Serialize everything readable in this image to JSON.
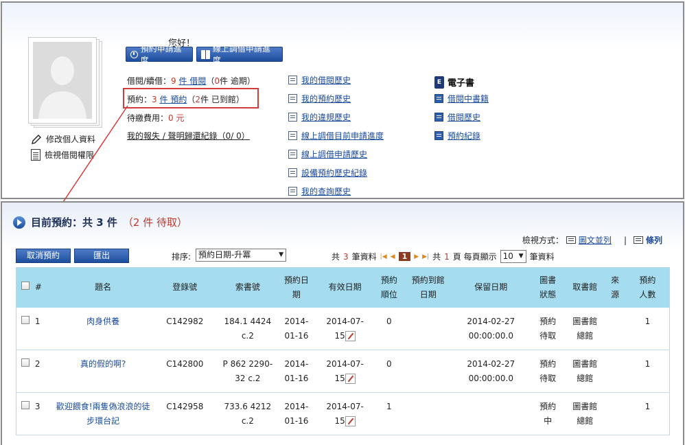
{
  "header": {
    "greeting": "您好！",
    "buttons": [
      {
        "label": "預約申請進度",
        "icon": "clock-icon"
      },
      {
        "label": "線上調借申請進度",
        "icon": "book-icon"
      }
    ]
  },
  "profile": {
    "edit_label": "修改個人資料",
    "permissions_label": "檢視借閱權限"
  },
  "summary": {
    "borrow": {
      "label": "借閱/續借：",
      "count": "9",
      "unit": "件",
      "link": "借閱",
      "overdue_open": "（",
      "overdue": "0",
      "overdue_text": "件 逾期）"
    },
    "reserve": {
      "label": "預約：",
      "count": "3",
      "unit": "件",
      "link": "預約",
      "arrived_open": "（",
      "arrived": "2",
      "arrived_text": "件 已到館）"
    },
    "fee": {
      "label": "待繳費用：",
      "value": "0",
      "unit": "元"
    },
    "lost_link": "我的報失 / 聲明歸還紀錄（0/ 0）"
  },
  "history_links": [
    "我的借閱歷史",
    "我的預約歷史",
    "我的違規歷史",
    "線上調借目前申請進度",
    "線上調借申請歷史",
    "設備預約歷史紀錄",
    "我的查詢歷史"
  ],
  "ebook": {
    "icon_text": "E",
    "title": "電子書",
    "links": [
      "借閱中書籍",
      "借閱歷史",
      "預約紀錄"
    ]
  },
  "section": {
    "title": "目前預約：共 3 件",
    "pending": "（2 件 待取）"
  },
  "view_mode": {
    "label": "檢視方式：",
    "option1": "圖文並列",
    "separator": "|",
    "option2": "條列"
  },
  "toolbar": {
    "cancel_label": "取消預約",
    "export_label": "匯出",
    "sort_label": "排序:",
    "sort_value": "預約日期-升冪",
    "total_prefix": "共",
    "total_count": "3",
    "total_suffix": "筆資料",
    "current_page": "1",
    "pages_prefix": "共",
    "pages_count": "1",
    "pages_suffix": "頁 每頁顯示",
    "per_page": "10",
    "per_page_suffix": "筆資料"
  },
  "table": {
    "headers": [
      "#",
      "題名",
      "登錄號",
      "索書號",
      "預約日期",
      "有效日期",
      "預約順位",
      "預約到館日期",
      "保留日期",
      "圖書狀態",
      "取書館",
      "來源",
      "預約人數"
    ],
    "rows": [
      {
        "n": "1",
        "title": "肉身供養",
        "reg": "C142982",
        "call": "184.1 4424 c.2",
        "rdate": "2014-01-16",
        "vdate": "2014-07-15",
        "order": "0",
        "arrive": "",
        "hold": "2014-02-27 00:00:00.0",
        "status": "預約待取",
        "lib": "圖書館總館",
        "src": "",
        "people": "1"
      },
      {
        "n": "2",
        "title": "真的假的啊?",
        "reg": "C142800",
        "call": "P 862 2290-32 c.2",
        "rdate": "2014-01-16",
        "vdate": "2014-07-15",
        "order": "0",
        "arrive": "",
        "hold": "2014-02-27 00:00:00.0",
        "status": "預約待取",
        "lib": "圖書館總館",
        "src": "",
        "people": "1"
      },
      {
        "n": "3",
        "title": "歡迎餵食!兩隻偽浪浪的徒步環台記",
        "reg": "C142958",
        "call": "733.6 4212 c.2",
        "rdate": "2014-01-16",
        "vdate": "2014-07-15",
        "order": "1",
        "arrive": "",
        "hold": "",
        "status": "預約中",
        "lib": "圖書館總館",
        "src": "",
        "people": "1"
      }
    ]
  }
}
